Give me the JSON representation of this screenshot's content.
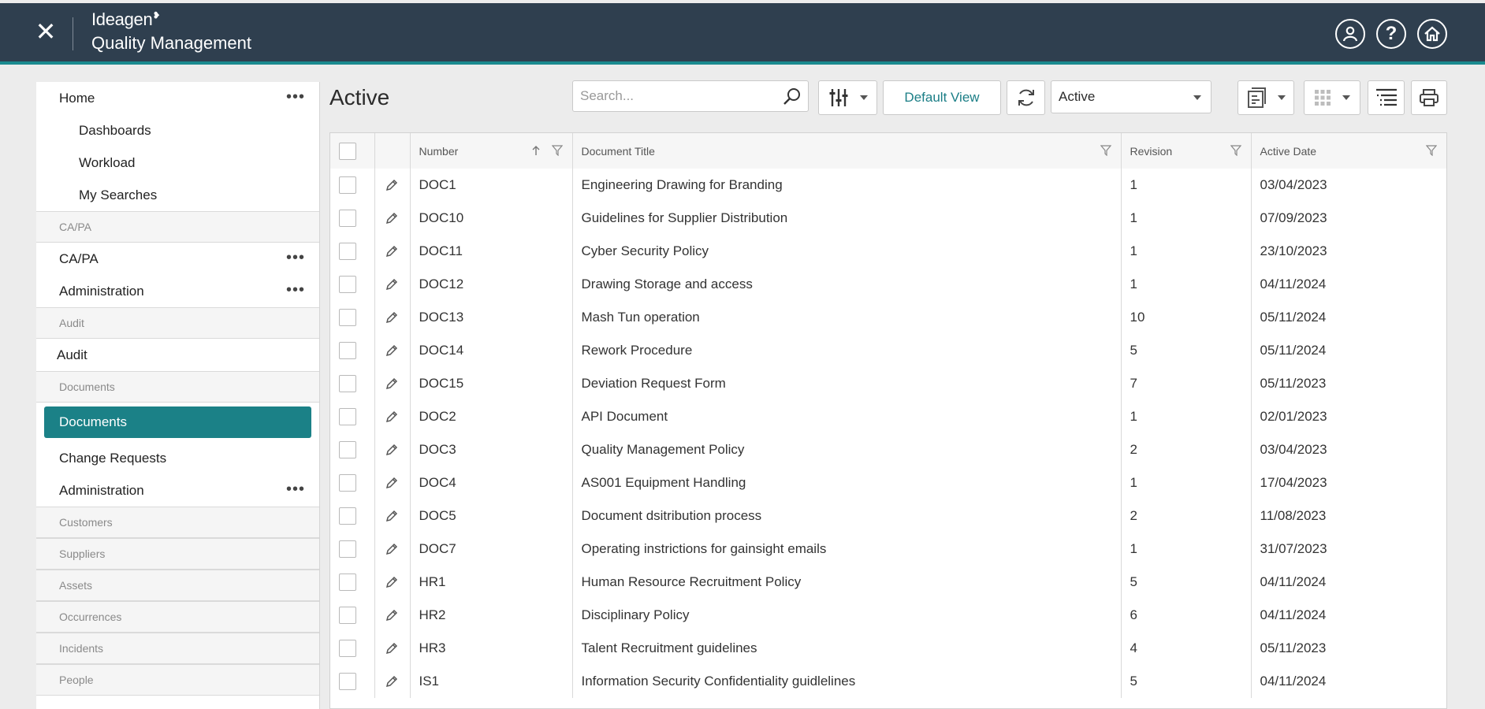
{
  "header": {
    "close_label": "✕",
    "brand_name": "Ideagen",
    "product_name": "Quality Management"
  },
  "sidebar": {
    "items": [
      {
        "type": "item",
        "label": "Home",
        "dots": true
      },
      {
        "type": "sub",
        "label": "Dashboards"
      },
      {
        "type": "sub",
        "label": "Workload"
      },
      {
        "type": "sub",
        "label": "My Searches"
      },
      {
        "type": "section",
        "label": "CA/PA"
      },
      {
        "type": "item",
        "label": "CA/PA",
        "dots": true
      },
      {
        "type": "item",
        "label": "Administration",
        "dots": true
      },
      {
        "type": "section",
        "label": "Audit"
      },
      {
        "type": "item",
        "label": "Audit"
      },
      {
        "type": "section",
        "label": "Documents"
      },
      {
        "type": "active",
        "label": "Documents"
      },
      {
        "type": "item",
        "label": "Change Requests"
      },
      {
        "type": "item",
        "label": "Administration",
        "dots": true
      },
      {
        "type": "section",
        "label": "Customers"
      },
      {
        "type": "section",
        "label": "Suppliers"
      },
      {
        "type": "section",
        "label": "Assets"
      },
      {
        "type": "section",
        "label": "Occurrences"
      },
      {
        "type": "section",
        "label": "Incidents"
      },
      {
        "type": "section",
        "label": "People"
      }
    ],
    "dots_label": "•••"
  },
  "main": {
    "title": "Active",
    "search_placeholder": "Search...",
    "default_view_label": "Default View",
    "view_select_value": "Active"
  },
  "table": {
    "columns": [
      "Number",
      "Document Title",
      "Revision",
      "Active Date"
    ],
    "rows": [
      [
        "DOC1",
        "Engineering Drawing for Branding",
        "1",
        "03/04/2023"
      ],
      [
        "DOC10",
        "Guidelines for Supplier Distribution",
        "1",
        "07/09/2023"
      ],
      [
        "DOC11",
        "Cyber Security Policy",
        "1",
        "23/10/2023"
      ],
      [
        "DOC12",
        "Drawing Storage and access",
        "1",
        "04/11/2024"
      ],
      [
        "DOC13",
        "Mash Tun operation",
        "10",
        "05/11/2024"
      ],
      [
        "DOC14",
        "Rework Procedure",
        "5",
        "05/11/2024"
      ],
      [
        "DOC15",
        "Deviation Request Form",
        "7",
        "05/11/2023"
      ],
      [
        "DOC2",
        "API Document",
        "1",
        "02/01/2023"
      ],
      [
        "DOC3",
        "Quality Management Policy",
        "2",
        "03/04/2023"
      ],
      [
        "DOC4",
        "AS001 Equipment Handling",
        "1",
        "17/04/2023"
      ],
      [
        "DOC5",
        "Document dsitribution process",
        "2",
        "11/08/2023"
      ],
      [
        "DOC7",
        "Operating instrictions for gainsight emails",
        "1",
        "31/07/2023"
      ],
      [
        "HR1",
        "Human Resource Recruitment Policy",
        "5",
        "04/11/2024"
      ],
      [
        "HR2",
        "Disciplinary Policy",
        "6",
        "04/11/2024"
      ],
      [
        "HR3",
        "Talent Recruitment guidelines",
        "4",
        "05/11/2023"
      ],
      [
        "IS1",
        "Information Security Confidentiality guidlelines",
        "5",
        "04/11/2024"
      ]
    ]
  },
  "colors": {
    "header_bg": "#2f3f4f",
    "accent_teal": "#1b8187",
    "page_bg": "#ececec"
  },
  "icons": [
    "close-icon",
    "user-icon",
    "help-icon",
    "home-icon",
    "more-icon",
    "search-icon",
    "filter-settings-icon",
    "refresh-icon",
    "report-icon",
    "grid-icon",
    "column-list-icon",
    "print-icon",
    "sort-up-icon",
    "filter-icon",
    "edit-icon"
  ]
}
